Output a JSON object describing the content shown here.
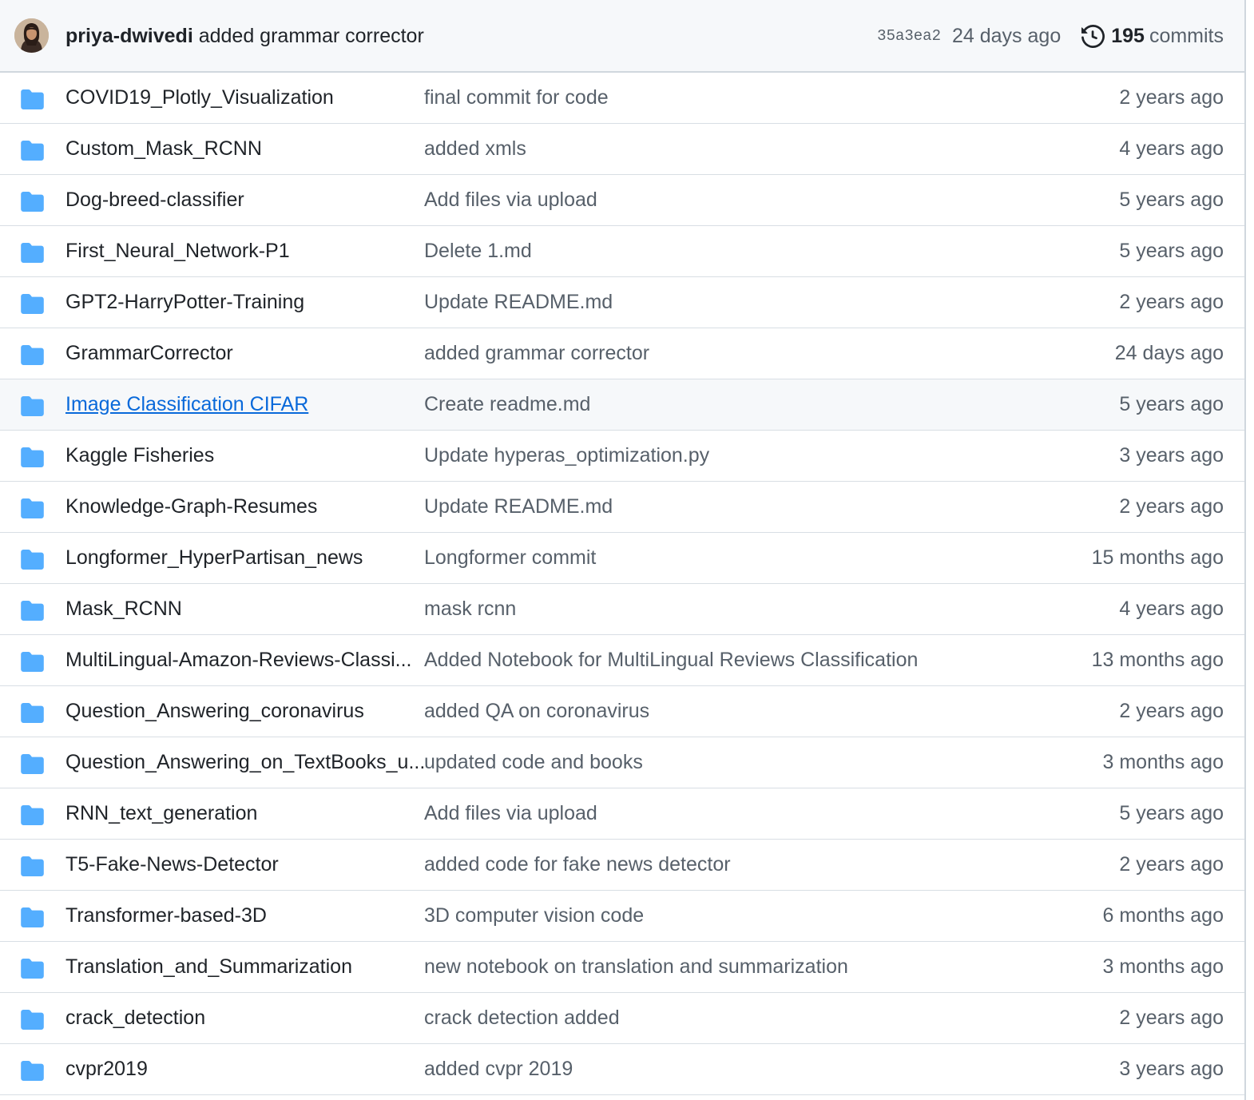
{
  "latest_commit": {
    "author": "priya-dwivedi",
    "message": "added grammar corrector",
    "sha": "35a3ea2",
    "age": "24 days ago",
    "commit_count": "195",
    "commit_label": "commits",
    "history_icon": "history-icon"
  },
  "colors": {
    "folder": "#54aeff",
    "link": "#0969da",
    "muted": "#57606a",
    "header_bg": "#f6f8fa"
  },
  "files": [
    {
      "name": "COVID19_Plotly_Visualization",
      "message": "final commit for code",
      "age": "2 years ago"
    },
    {
      "name": "Custom_Mask_RCNN",
      "message": "added xmls",
      "age": "4 years ago"
    },
    {
      "name": "Dog-breed-classifier",
      "message": "Add files via upload",
      "age": "5 years ago"
    },
    {
      "name": "First_Neural_Network-P1",
      "message": "Delete 1.md",
      "age": "5 years ago"
    },
    {
      "name": "GPT2-HarryPotter-Training",
      "message": "Update README.md",
      "age": "2 years ago"
    },
    {
      "name": "GrammarCorrector",
      "message": "added grammar corrector",
      "age": "24 days ago"
    },
    {
      "name": "Image Classification CIFAR",
      "message": "Create readme.md",
      "age": "5 years ago",
      "hovered": true
    },
    {
      "name": "Kaggle Fisheries",
      "message": "Update hyperas_optimization.py",
      "age": "3 years ago"
    },
    {
      "name": "Knowledge-Graph-Resumes",
      "message": "Update README.md",
      "age": "2 years ago"
    },
    {
      "name": "Longformer_HyperPartisan_news",
      "message": "Longformer commit",
      "age": "15 months ago"
    },
    {
      "name": "Mask_RCNN",
      "message": "mask rcnn",
      "age": "4 years ago"
    },
    {
      "name": "MultiLingual-Amazon-Reviews-Classi...",
      "message": "Added Notebook for MultiLingual Reviews Classification",
      "age": "13 months ago"
    },
    {
      "name": "Question_Answering_coronavirus",
      "message": "added QA on coronavirus",
      "age": "2 years ago"
    },
    {
      "name": "Question_Answering_on_TextBooks_u...",
      "message": "updated code and books",
      "age": "3 months ago"
    },
    {
      "name": "RNN_text_generation",
      "message": "Add files via upload",
      "age": "5 years ago"
    },
    {
      "name": "T5-Fake-News-Detector",
      "message": "added code for fake news detector",
      "age": "2 years ago"
    },
    {
      "name": "Transformer-based-3D",
      "message": "3D computer vision code",
      "age": "6 months ago"
    },
    {
      "name": "Translation_and_Summarization",
      "message": "new notebook on translation and summarization",
      "age": "3 months ago"
    },
    {
      "name": "crack_detection",
      "message": "crack detection added",
      "age": "2 years ago"
    },
    {
      "name": "cvpr2019",
      "message": "added cvpr 2019",
      "age": "3 years ago"
    }
  ]
}
